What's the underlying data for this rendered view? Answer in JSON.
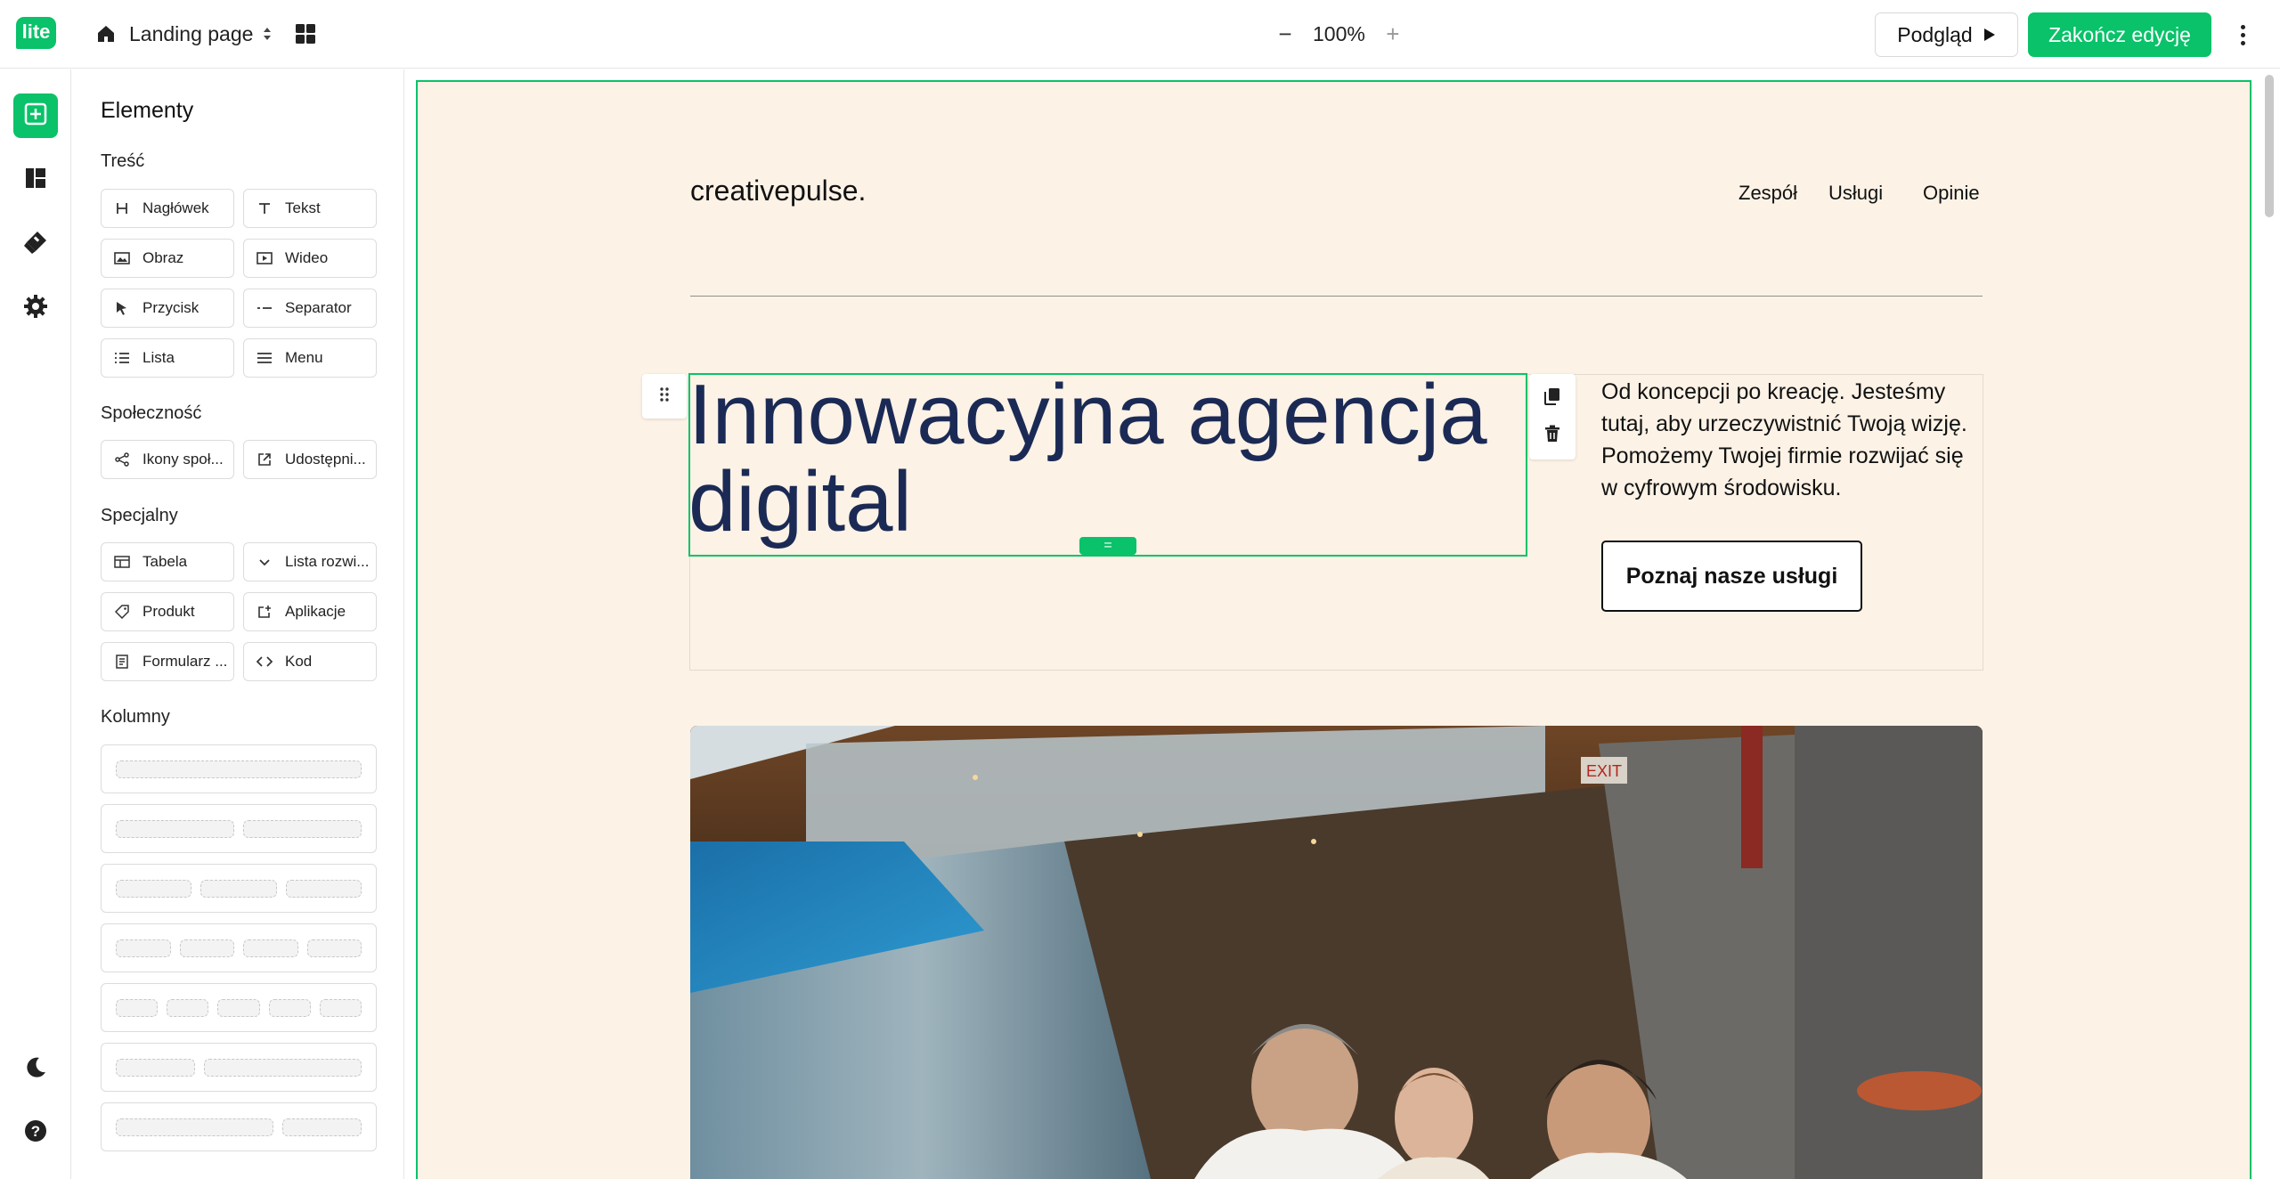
{
  "app": {
    "logo_text": "lite",
    "page_name": "Landing page",
    "zoom_level": "100%",
    "zoom_minus": "−",
    "zoom_plus": "+",
    "preview_label": "Podgląd",
    "finish_label": "Zakończ edycję",
    "accent_color": "#09c269"
  },
  "rail": {
    "items": [
      {
        "icon": "add-element-icon",
        "active": true
      },
      {
        "icon": "layout-icon",
        "active": false
      },
      {
        "icon": "paint-icon",
        "active": false
      },
      {
        "icon": "gear-icon",
        "active": false
      }
    ],
    "bottom": [
      {
        "icon": "moon-icon"
      },
      {
        "icon": "help-icon"
      }
    ]
  },
  "panel": {
    "title": "Elementy",
    "sections": {
      "content": {
        "title": "Treść",
        "items": [
          {
            "label": "Nagłówek",
            "icon": "heading-icon"
          },
          {
            "label": "Tekst",
            "icon": "text-icon"
          },
          {
            "label": "Obraz",
            "icon": "image-icon"
          },
          {
            "label": "Wideo",
            "icon": "video-icon"
          },
          {
            "label": "Przycisk",
            "icon": "cursor-icon"
          },
          {
            "label": "Separator",
            "icon": "separator-icon"
          },
          {
            "label": "Lista",
            "icon": "list-icon"
          },
          {
            "label": "Menu",
            "icon": "menu-icon"
          }
        ]
      },
      "social": {
        "title": "Społeczność",
        "items": [
          {
            "label": "Ikony społ...",
            "icon": "share-icon"
          },
          {
            "label": "Udostępni...",
            "icon": "external-link-icon"
          }
        ]
      },
      "special": {
        "title": "Specjalny",
        "items": [
          {
            "label": "Tabela",
            "icon": "table-icon"
          },
          {
            "label": "Lista rozwi...",
            "icon": "chevron-down-icon"
          },
          {
            "label": "Produkt",
            "icon": "tag-icon"
          },
          {
            "label": "Aplikacje",
            "icon": "apps-icon"
          },
          {
            "label": "Formularz ...",
            "icon": "form-icon"
          },
          {
            "label": "Kod",
            "icon": "code-icon"
          }
        ]
      },
      "columns": {
        "title": "Kolumny"
      }
    }
  },
  "canvas": {
    "brand": "creativepulse.",
    "nav": [
      "Zespół",
      "Usługi",
      "Opinie"
    ],
    "heading": "Innowacyjna agencja digital",
    "paragraph": "Od koncepcji po kreację. Jesteśmy tutaj, aby urzeczywistnić Twoją wizję. Pomożemy Twojej firmie rozwijać się w cyfrowym środowisku.",
    "cta_label": "Poznaj nasze usługi",
    "resize_handle": "=",
    "background_color": "#fcf2e6",
    "heading_color": "#1b2a55"
  }
}
